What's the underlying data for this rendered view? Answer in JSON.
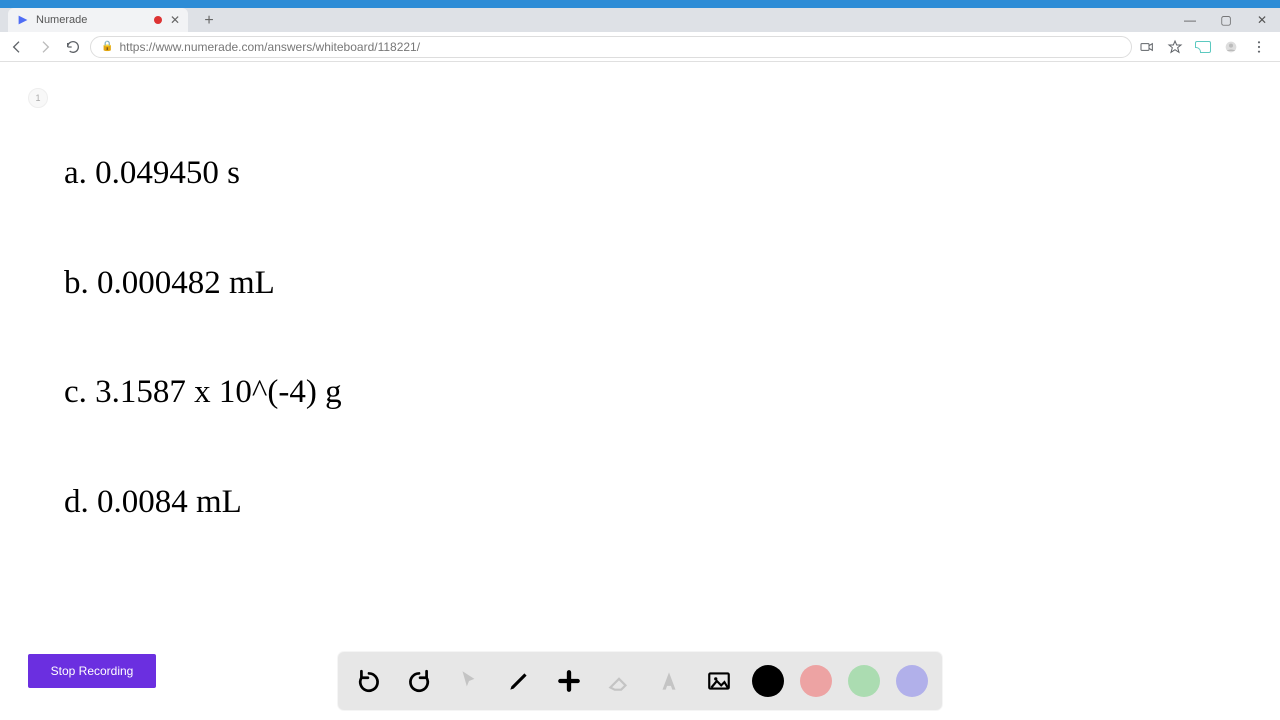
{
  "browser": {
    "tab_title": "Numerade",
    "url": "https://www.numerade.com/answers/whiteboard/118221/"
  },
  "page_badge": "1",
  "content": {
    "lines": [
      "a. 0.049450 s",
      "b. 0.000482 mL",
      "c. 3.1587 x 10^(-4) g",
      "d. 0.0084 mL"
    ]
  },
  "stop_recording_label": "Stop Recording",
  "toolbar": {
    "swatches": [
      "black",
      "pink",
      "green",
      "purple"
    ]
  }
}
